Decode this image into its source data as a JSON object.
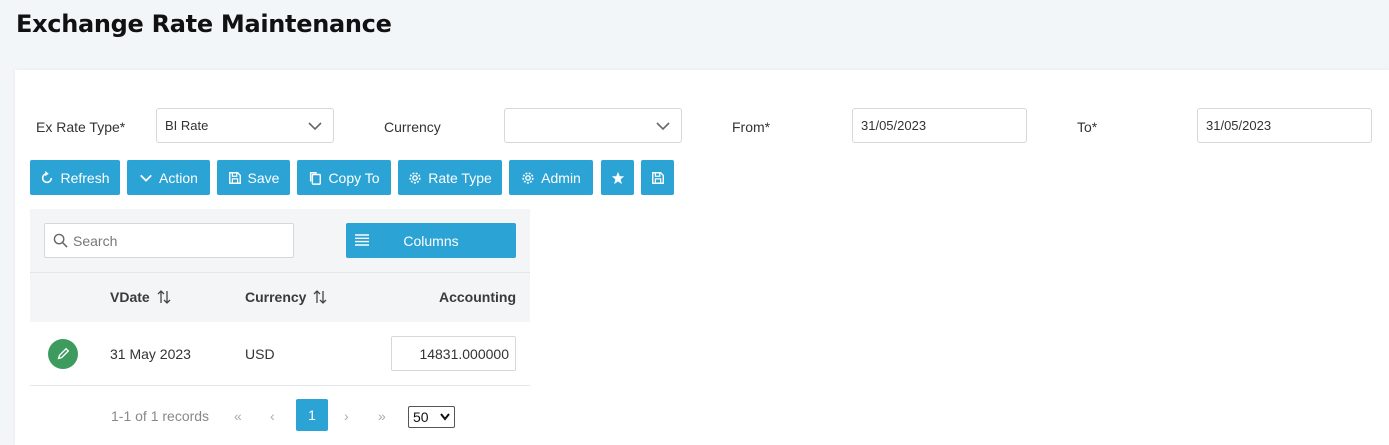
{
  "page": {
    "title": "Exchange Rate Maintenance"
  },
  "filters": {
    "ex_rate_type_label": "Ex Rate Type*",
    "ex_rate_type_value": "BI Rate",
    "currency_label": "Currency",
    "currency_value": "",
    "from_label": "From*",
    "from_value": "31/05/2023",
    "to_label": "To*",
    "to_value": "31/05/2023"
  },
  "toolbar": {
    "refresh": "Refresh",
    "action": "Action",
    "save": "Save",
    "copy_to": "Copy To",
    "rate_type": "Rate Type",
    "admin": "Admin"
  },
  "grid": {
    "search_placeholder": "Search",
    "columns_label": "Columns",
    "headers": {
      "vdate": "VDate",
      "currency": "Currency",
      "accounting": "Accounting"
    },
    "rows": [
      {
        "vdate": "31 May 2023",
        "currency": "USD",
        "accounting": "14831.000000"
      }
    ],
    "pager": {
      "summary": "1-1 of 1 records",
      "first": "«",
      "prev": "‹",
      "current": "1",
      "next": "›",
      "last": "»",
      "page_size": "50"
    }
  },
  "colors": {
    "accent": "#2ba3d5",
    "edit": "#3d9b5e",
    "background": "#f3f6f9"
  }
}
